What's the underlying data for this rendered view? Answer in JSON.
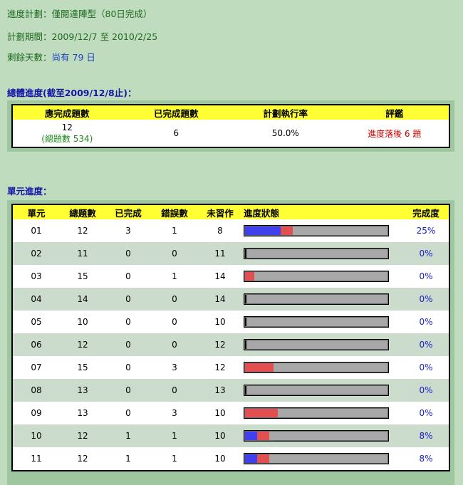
{
  "plan": {
    "plan_label": "進度計劃：",
    "plan_value": "僅閱達陣型（80日完成）",
    "period_label": "計劃期間：",
    "period_value": "2009/12/7 至 2010/2/25",
    "remain_label": "剩餘天數：",
    "remain_value": "尚有 79 日"
  },
  "overall": {
    "title": "總體進度(截至2009/12/8止)：",
    "headers": [
      "應完成題數",
      "已完成題數",
      "計劃執行率",
      "評鑑"
    ],
    "due": "12",
    "due_total": "(總題數 534)",
    "done": "6",
    "rate": "50.0%",
    "evaluation": "進度落後 6 題"
  },
  "units": {
    "title": "單元進度：",
    "headers": [
      "單元",
      "總題數",
      "已完成",
      "錯誤數",
      "未習作",
      "進度狀態",
      "完成度"
    ],
    "rows": [
      {
        "unit": "01",
        "total": "12",
        "done": "3",
        "wrong": "1",
        "todo": "8",
        "pct": "25%"
      },
      {
        "unit": "02",
        "total": "11",
        "done": "0",
        "wrong": "0",
        "todo": "11",
        "pct": "0%"
      },
      {
        "unit": "03",
        "total": "15",
        "done": "0",
        "wrong": "1",
        "todo": "14",
        "pct": "0%"
      },
      {
        "unit": "04",
        "total": "14",
        "done": "0",
        "wrong": "0",
        "todo": "14",
        "pct": "0%"
      },
      {
        "unit": "05",
        "total": "10",
        "done": "0",
        "wrong": "0",
        "todo": "10",
        "pct": "0%"
      },
      {
        "unit": "06",
        "total": "12",
        "done": "0",
        "wrong": "0",
        "todo": "12",
        "pct": "0%"
      },
      {
        "unit": "07",
        "total": "15",
        "done": "0",
        "wrong": "3",
        "todo": "12",
        "pct": "0%"
      },
      {
        "unit": "08",
        "total": "13",
        "done": "0",
        "wrong": "0",
        "todo": "13",
        "pct": "0%"
      },
      {
        "unit": "09",
        "total": "13",
        "done": "0",
        "wrong": "3",
        "todo": "10",
        "pct": "0%"
      },
      {
        "unit": "10",
        "total": "12",
        "done": "1",
        "wrong": "1",
        "todo": "10",
        "pct": "8%"
      },
      {
        "unit": "11",
        "total": "12",
        "done": "1",
        "wrong": "1",
        "todo": "10",
        "pct": "8%"
      }
    ]
  },
  "colors": {
    "done_bar": "#4040ee",
    "error_bar": "#e05050",
    "remaining_bar": "#a8a8a8",
    "header_bg": "#ffff33"
  }
}
